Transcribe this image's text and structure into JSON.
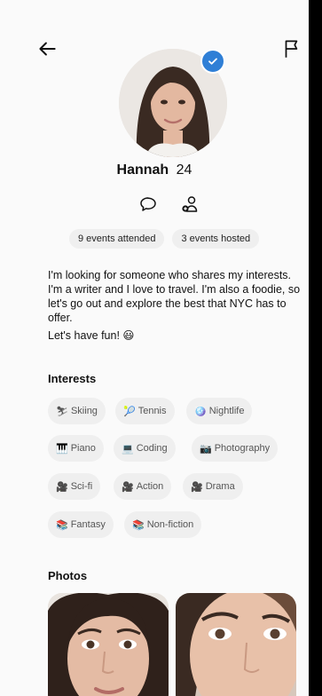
{
  "profile": {
    "name": "Hannah",
    "age": "24",
    "verified": true
  },
  "stats": [
    "9 events attended",
    "3 events hosted"
  ],
  "bio": {
    "text": "I'm looking for someone who shares my interests. I'm a writer and I love to travel. I'm also a foodie, so let's go out and explore the best that NYC has to offer.",
    "closing": "Let's have fun! 😃"
  },
  "interests": {
    "title": "Interests",
    "items": [
      {
        "icon": "⛷",
        "label": "Skiing"
      },
      {
        "icon": "🎾",
        "label": "Tennis"
      },
      {
        "icon": "🪩",
        "label": "Nightlife"
      },
      {
        "icon": "🎹",
        "label": "Piano"
      },
      {
        "icon": "💻",
        "label": "Coding"
      },
      {
        "icon": "📷",
        "label": "Photography"
      },
      {
        "icon": "🎥",
        "label": "Sci-fi"
      },
      {
        "icon": "🎥",
        "label": "Action"
      },
      {
        "icon": "🎥",
        "label": "Drama"
      },
      {
        "icon": "📚",
        "label": "Fantasy"
      },
      {
        "icon": "📚",
        "label": "Non-fiction"
      }
    ]
  },
  "photos": {
    "title": "Photos",
    "count": 2
  },
  "colors": {
    "background": "#fafafa",
    "chip": "#efefef",
    "verified": "#2f7fd6"
  }
}
